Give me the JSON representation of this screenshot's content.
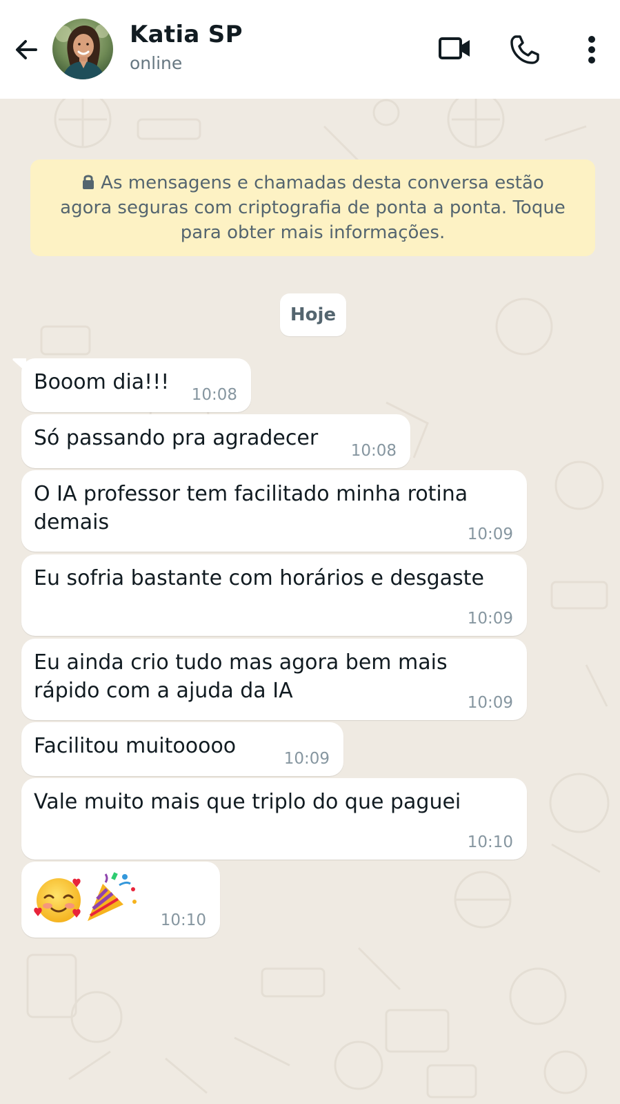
{
  "header": {
    "contact_name": "Katia SP",
    "status": "online",
    "icons": [
      "back-arrow-icon",
      "video-call-icon",
      "phone-icon",
      "more-options-icon"
    ]
  },
  "chat": {
    "encryption_notice": "As mensagens e chamadas desta conversa estão agora seguras com criptografia de ponta a ponta. Toque para obter mais informações.",
    "encryption_lines": [
      "As mensagens e chamadas desta conversa estão",
      "agora seguras com criptografia de ponta a ponta. Toque",
      "para obter mais informações."
    ],
    "date_label": "Hoje",
    "messages": [
      {
        "lines": [
          "Booom dia!!!"
        ],
        "time": "10:08"
      },
      {
        "lines": [
          "Só passando pra agradecer"
        ],
        "time": "10:08"
      },
      {
        "lines": [
          "O IA professor tem facilitado minha rotina",
          "demais"
        ],
        "time": "10:09"
      },
      {
        "lines": [
          "Eu sofria bastante com horários e desgaste"
        ],
        "time": "10:09"
      },
      {
        "lines": [
          "Eu ainda crio tudo mas agora bem mais",
          "rápido com a ajuda da IA"
        ],
        "time": "10:09"
      },
      {
        "lines": [
          "Facilitou muitooooo"
        ],
        "time": "10:09"
      },
      {
        "lines": [
          "Vale muito mais que triplo do que paguei"
        ],
        "time": "10:10"
      },
      {
        "lines": [
          "🥰🎉"
        ],
        "emoji": [
          "smiling-face-with-hearts-emoji",
          "party-popper-emoji"
        ],
        "time": "10:10"
      }
    ]
  },
  "colors": {
    "chat_background": "#efeae2",
    "bubble": "#ffffff",
    "notice_background": "#fdf2c4",
    "timestamp": "#8696a0",
    "secondary_text": "#667781"
  }
}
